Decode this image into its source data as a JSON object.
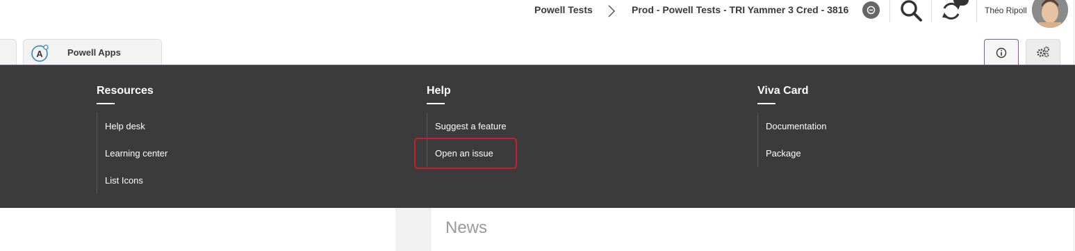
{
  "header": {
    "breadcrumb": [
      {
        "label": "Powell Tests"
      },
      {
        "label": "Prod - Powell Tests - TRI Yammer 3 Cred - 3816"
      }
    ],
    "user_name": "Théo Ripoll"
  },
  "tabs": {
    "app_tab_label": "Powell Apps"
  },
  "menu": {
    "columns": [
      {
        "title": "Resources",
        "links": [
          "Help desk",
          "Learning center",
          "List Icons"
        ]
      },
      {
        "title": "Help",
        "links": [
          "Suggest a feature",
          "Open an issue"
        ]
      },
      {
        "title": "Viva Card",
        "links": [
          "Documentation",
          "Package"
        ]
      }
    ],
    "highlighted_link": "Open an issue"
  },
  "content": {
    "news_title": "News"
  },
  "colors": {
    "menu_background": "#3b3b3b",
    "highlight_border": "#c8202a",
    "active_tab_border": "#7b5b9c"
  },
  "icons": [
    "chevron-right-icon",
    "circle-nav-icon",
    "search-icon",
    "sync-icon",
    "app-logo-icon",
    "info-icon",
    "gears-icon"
  ]
}
